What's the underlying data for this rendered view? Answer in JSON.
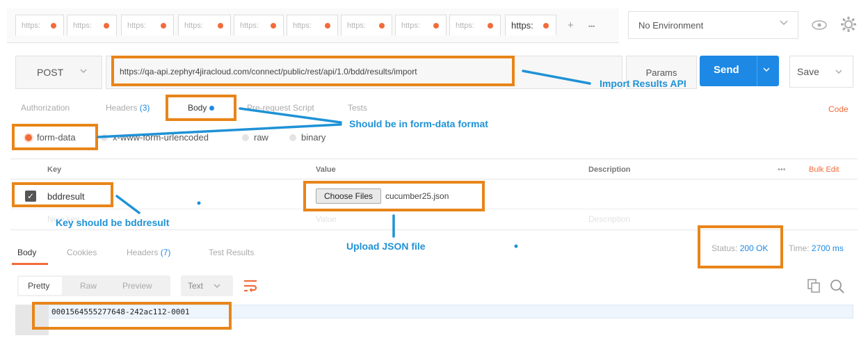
{
  "tabs": {
    "items": [
      {
        "label": "https:"
      },
      {
        "label": "https:"
      },
      {
        "label": "https:"
      },
      {
        "label": "https:"
      },
      {
        "label": "https:"
      },
      {
        "label": "https:"
      },
      {
        "label": "https:"
      },
      {
        "label": "https:"
      },
      {
        "label": "https:"
      },
      {
        "label": "https:"
      }
    ],
    "add_label": "+",
    "more_label": "•••"
  },
  "environment": {
    "selected": "No Environment"
  },
  "request": {
    "method": "POST",
    "url": "https://qa-api.zephyr4jiracloud.com/connect/public/rest/api/1.0/bdd/results/import",
    "params_label": "Params",
    "send_label": "Send",
    "save_label": "Save"
  },
  "request_tabs": {
    "authorization": "Authorization",
    "headers": "Headers",
    "headers_count": "(3)",
    "body": "Body",
    "prerequest": "Pre-request Script",
    "tests": "Tests",
    "code": "Code"
  },
  "body_modes": {
    "form_data": "form-data",
    "urlencoded": "x-www-form-urlencoded",
    "raw": "raw",
    "binary": "binary"
  },
  "kv_table": {
    "headers": {
      "key": "Key",
      "value": "Value",
      "description": "Description",
      "more": "•••",
      "bulk_edit": "Bulk Edit"
    },
    "row": {
      "key": "bddresult",
      "choose_label": "Choose Files",
      "file": "cucumber25.json"
    },
    "placeholder": {
      "key": "New key",
      "value": "Value",
      "description": "Description"
    }
  },
  "response": {
    "tabs": {
      "body": "Body",
      "cookies": "Cookies",
      "headers": "Headers",
      "headers_count": "(7)",
      "tests": "Test Results"
    },
    "status_label": "Status:",
    "status_value": "200 OK",
    "time_label": "Time:",
    "time_value": "2700 ms",
    "formats": {
      "pretty": "Pretty",
      "raw": "Raw",
      "preview": "Preview"
    },
    "text_select": "Text",
    "body_text": "0001564555277648-242ac112-0001"
  },
  "annotations": {
    "import_api": "Import Results API",
    "form_data_note": "Should be in form-data format",
    "key_note": "Key should be bddresult",
    "upload_note": "Upload JSON file"
  },
  "colors": {
    "accent": "#f26b3a",
    "send_blue": "#1d89e4",
    "annotation_orange": "#e8851a",
    "annotation_blue": "#1f92d6"
  }
}
